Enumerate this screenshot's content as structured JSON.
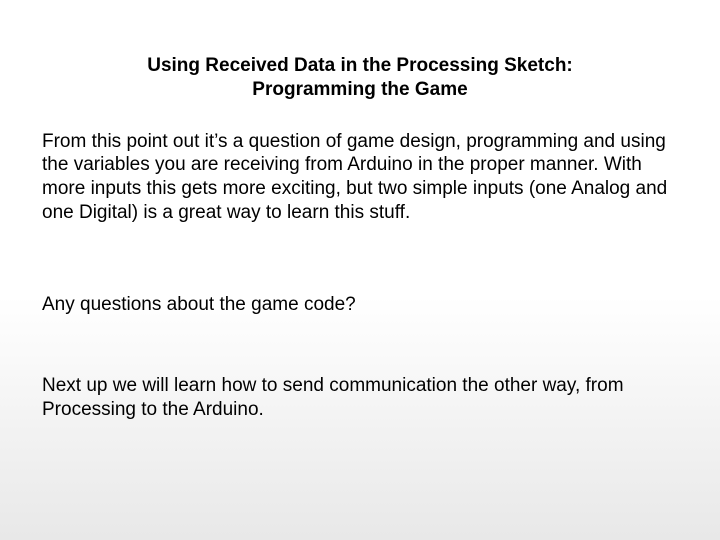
{
  "title_line1": "Using Received Data in the Processing Sketch:",
  "title_line2": "Programming the Game",
  "paragraph1": "From this point out it’s a question of game design, programming and using the variables you are receiving from Arduino in the proper manner. With more inputs this gets more exciting, but two simple inputs (one Analog and one Digital) is a great way to learn this stuff.",
  "paragraph2": "Any questions about the game code?",
  "paragraph3": "Next up we will learn how to send communication the other way, from Processing to the Arduino."
}
